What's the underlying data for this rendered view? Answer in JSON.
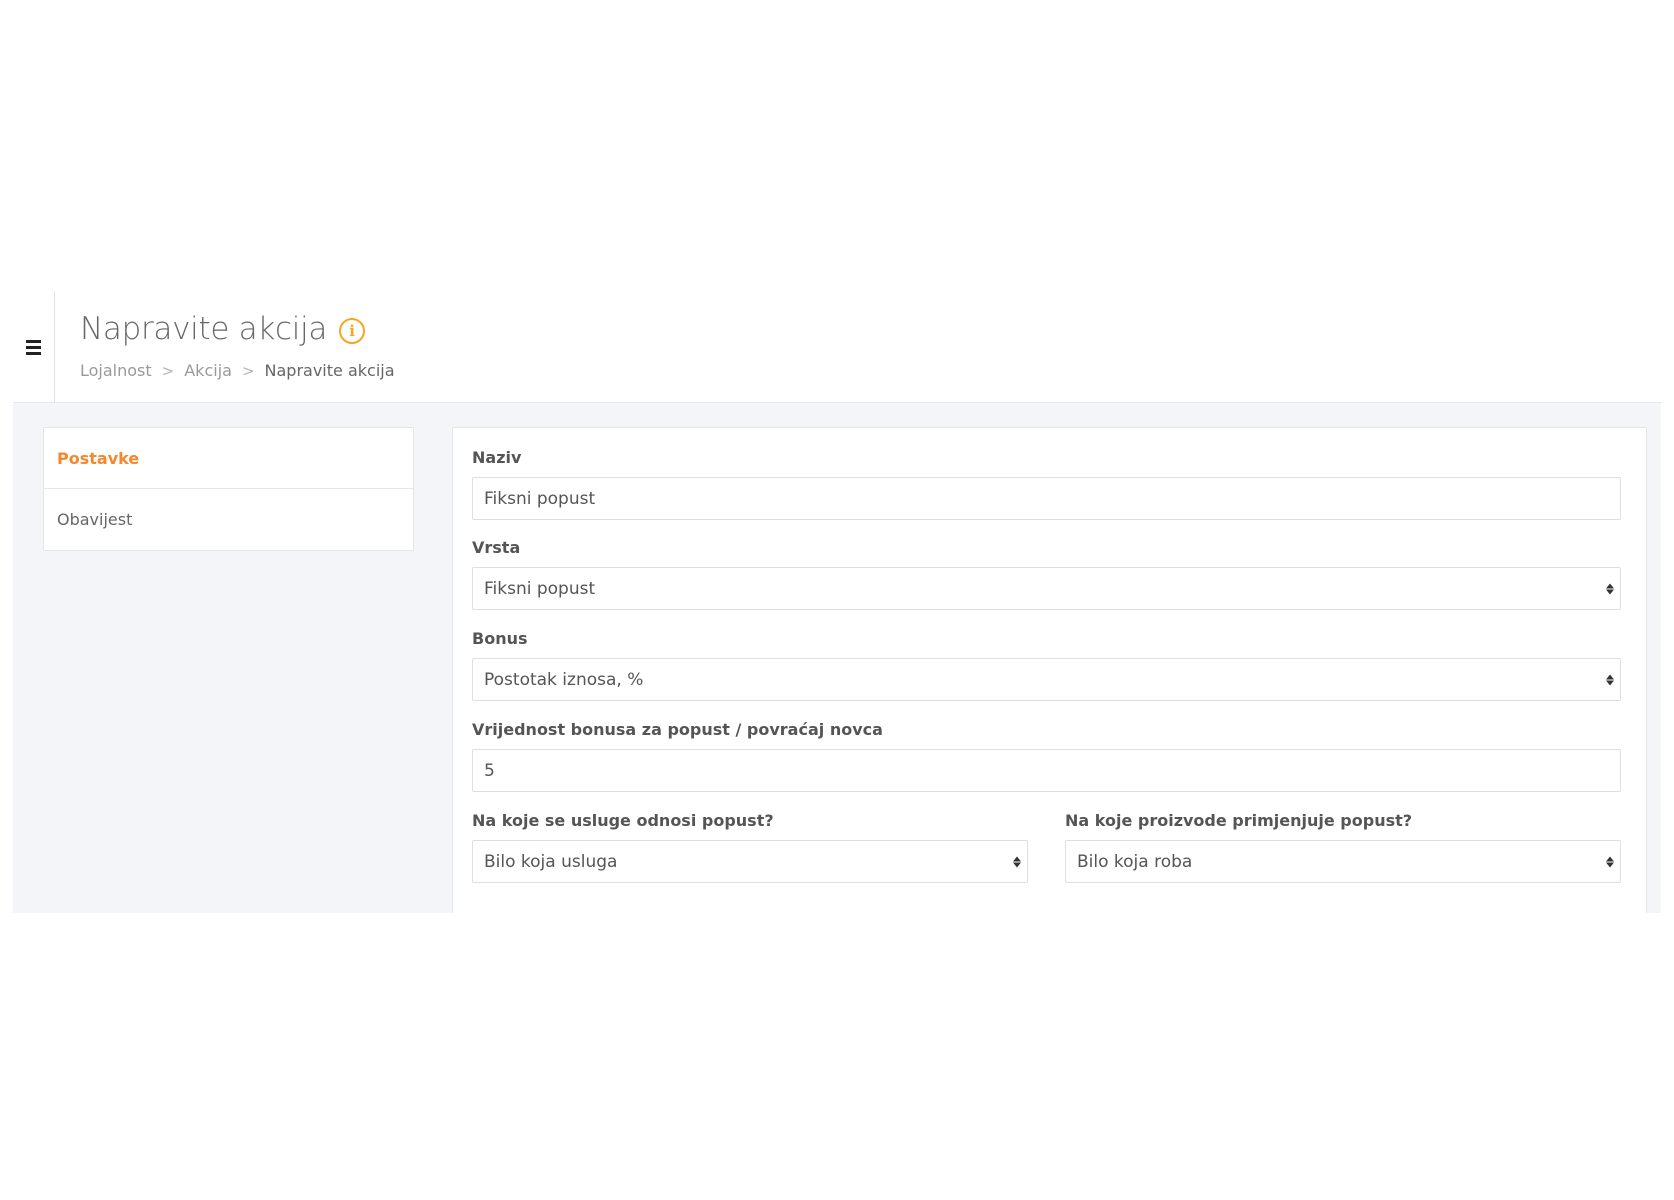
{
  "header": {
    "title": "Napravite akcija",
    "breadcrumb": [
      "Lojalnost",
      "Akcija",
      "Napravite akcija"
    ],
    "separator": ">"
  },
  "sidebar": {
    "items": [
      {
        "label": "Postavke",
        "active": true
      },
      {
        "label": "Obavijest",
        "active": false
      }
    ]
  },
  "form": {
    "naziv": {
      "label": "Naziv",
      "value": "Fiksni popust"
    },
    "vrsta": {
      "label": "Vrsta",
      "value": "Fiksni popust"
    },
    "bonus": {
      "label": "Bonus",
      "value": "Postotak iznosa, %"
    },
    "vrijednost": {
      "label": "Vrijednost bonusa za popust / povraćaj novca",
      "value": "5"
    },
    "usluge": {
      "label": "Na koje se usluge odnosi popust?",
      "value": "Bilo koja usluga"
    },
    "proizvodi": {
      "label": "Na koje proizvode primjenjuje popust?",
      "value": "Bilo koja roba"
    }
  },
  "colors": {
    "accent": "#f5872c",
    "info_icon": "#f5a623",
    "background": "#f4f5f8"
  },
  "icons": {
    "menu": "hamburger-icon",
    "info": "info-icon",
    "select": "sort-arrows-icon"
  }
}
